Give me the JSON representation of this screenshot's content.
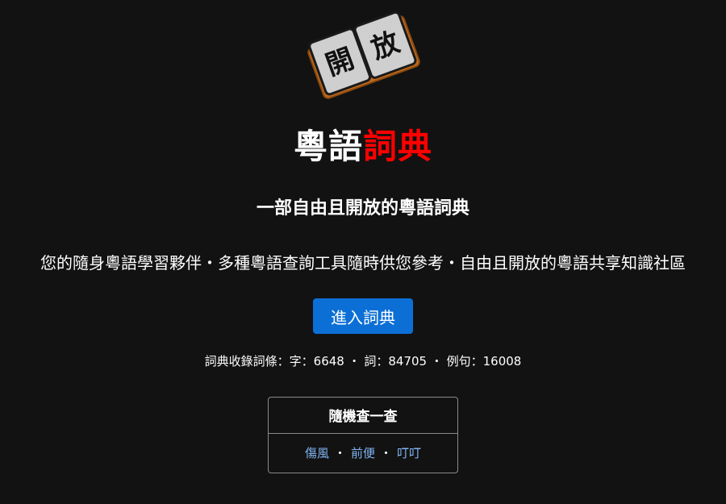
{
  "logo": {
    "left_char": "開",
    "right_char": "放",
    "colors": {
      "cover": "#c26a1b",
      "cover_edge": "#8a4a10",
      "page": "#cfcfcf",
      "page_edge": "#1a1a1a",
      "text": "#111111"
    }
  },
  "title": {
    "white_part": "粵語",
    "red_part": "詞典"
  },
  "subtitle": "一部自由且開放的粵語詞典",
  "tagline": "您的隨身粵語學習夥伴・多種粵語查詢工具隨時供您參考・自由且開放的粵語共享知識社區",
  "enter_button": {
    "label": "進入詞典",
    "color": "#0c6fd6"
  },
  "stats": {
    "text": "詞典收錄詞條：字：6648 ・ 詞：84705 ・ 例句：16008"
  },
  "random": {
    "header": "隨機查一查",
    "links": [
      "傷風",
      "前便",
      "叮叮"
    ],
    "separator": "・",
    "link_color": "#7fb3f0"
  },
  "colors": {
    "background": "#121212",
    "text": "#ffffff",
    "accent_red": "#ff0000"
  }
}
